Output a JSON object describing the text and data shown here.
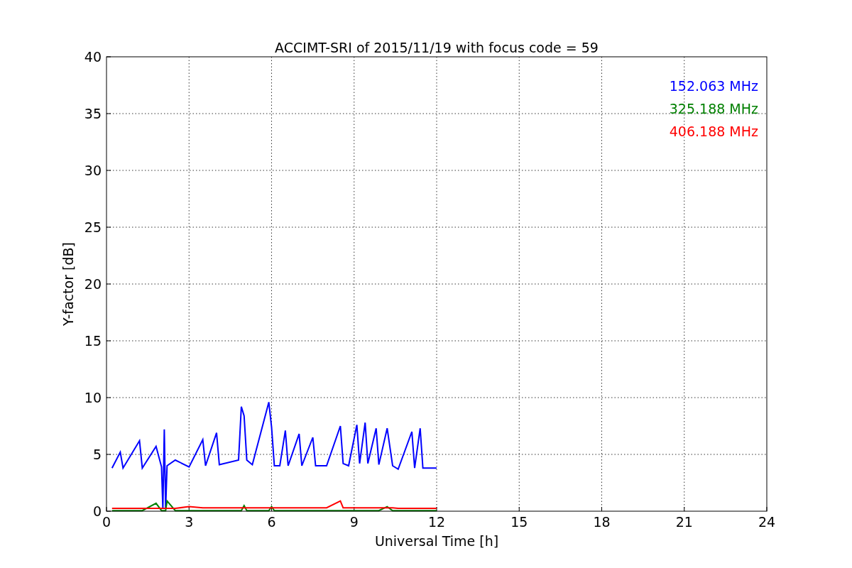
{
  "chart_data": {
    "type": "line",
    "title": "ACCIMT-SRI of 2015/11/19 with focus code = 59",
    "xlabel": "Universal Time [h]",
    "ylabel": "Y-factor [dB]",
    "xlim": [
      0,
      24
    ],
    "ylim": [
      0,
      40
    ],
    "xticks": [
      0,
      3,
      6,
      9,
      12,
      15,
      18,
      21,
      24
    ],
    "yticks": [
      0,
      5,
      10,
      15,
      20,
      25,
      30,
      35,
      40
    ],
    "grid": true,
    "x": [
      0.2,
      0.5,
      0.6,
      1.2,
      1.3,
      1.8,
      2.0,
      2.05,
      2.1,
      2.15,
      2.2,
      2.5,
      3.0,
      3.5,
      3.6,
      4.0,
      4.1,
      4.8,
      4.9,
      5.0,
      5.1,
      5.3,
      5.9,
      6.0,
      6.1,
      6.3,
      6.5,
      6.6,
      7.0,
      7.1,
      7.5,
      7.6,
      8.0,
      8.5,
      8.6,
      8.8,
      9.1,
      9.2,
      9.4,
      9.5,
      9.8,
      9.9,
      10.2,
      10.4,
      10.6,
      11.1,
      11.2,
      11.4,
      11.5,
      12.0
    ],
    "series": [
      {
        "name": "152.063 MHz",
        "color": "#0000ff",
        "values": [
          3.8,
          5.2,
          3.8,
          6.2,
          3.8,
          5.7,
          3.9,
          0.2,
          7.2,
          0.2,
          4.0,
          4.5,
          3.9,
          6.3,
          4.0,
          6.9,
          4.1,
          4.5,
          9.2,
          8.4,
          4.5,
          4.1,
          9.6,
          7.4,
          4.0,
          4.0,
          7.1,
          4.0,
          6.8,
          4.0,
          6.5,
          4.0,
          4.0,
          7.5,
          4.2,
          4.0,
          7.6,
          4.2,
          7.8,
          4.2,
          7.3,
          4.1,
          7.3,
          4.0,
          3.7,
          7.0,
          3.8,
          7.3,
          3.8,
          3.8
        ]
      },
      {
        "name": "325.188 MHz",
        "color": "#008000",
        "values": [
          0.05,
          0.05,
          0.05,
          0.05,
          0.05,
          0.7,
          0.05,
          0.05,
          0.05,
          0.05,
          0.9,
          0.05,
          0.05,
          0.05,
          0.05,
          0.05,
          0.05,
          0.05,
          0.05,
          0.5,
          0.05,
          0.05,
          0.05,
          0.4,
          0.05,
          0.05,
          0.05,
          0.05,
          0.05,
          0.05,
          0.05,
          0.05,
          0.05,
          0.05,
          0.05,
          0.05,
          0.05,
          0.05,
          0.05,
          0.05,
          0.05,
          0.05,
          0.4,
          0.05,
          0.05,
          0.05,
          0.05,
          0.05,
          0.05,
          0.05
        ]
      },
      {
        "name": "406.188 MHz",
        "color": "#ff0000",
        "values": [
          0.25,
          0.25,
          0.25,
          0.25,
          0.25,
          0.25,
          0.25,
          0.25,
          0.25,
          0.25,
          0.25,
          0.25,
          0.4,
          0.3,
          0.3,
          0.3,
          0.3,
          0.3,
          0.3,
          0.3,
          0.3,
          0.3,
          0.3,
          0.3,
          0.3,
          0.3,
          0.3,
          0.3,
          0.3,
          0.3,
          0.3,
          0.3,
          0.3,
          0.9,
          0.3,
          0.3,
          0.3,
          0.3,
          0.3,
          0.3,
          0.3,
          0.3,
          0.3,
          0.3,
          0.25,
          0.25,
          0.25,
          0.25,
          0.25,
          0.25
        ]
      }
    ]
  }
}
